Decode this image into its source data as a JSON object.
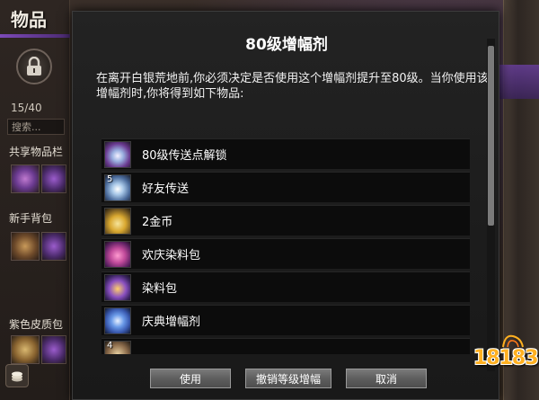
{
  "inventory": {
    "title": "物品",
    "count": "15/40",
    "search_placeholder": "搜索...",
    "categories": [
      "共享物品栏",
      "新手背包",
      "紫色皮质包"
    ]
  },
  "dialog": {
    "title": "80级增幅剂",
    "description": "在离开白银荒地前,你必须决定是否使用这个增幅剂提升至80级。当你使用该增幅剂时,你将得到如下物品:",
    "items": [
      {
        "label": "80级传送点解锁",
        "icon": "waypoint-crystal-icon",
        "badge": ""
      },
      {
        "label": "好友传送",
        "icon": "friend-teleport-icon",
        "badge": "5"
      },
      {
        "label": "2金币",
        "icon": "gold-coins-icon",
        "badge": ""
      },
      {
        "label": "欢庆染料包",
        "icon": "celebration-dye-pack-icon",
        "badge": ""
      },
      {
        "label": "染料包",
        "icon": "dye-pack-icon",
        "badge": ""
      },
      {
        "label": "庆典增幅剂",
        "icon": "celebration-booster-icon",
        "badge": ""
      },
      {
        "label": "",
        "icon": "next-item-icon",
        "badge": "4"
      }
    ],
    "buttons": {
      "use": "使用",
      "cancel_upgrade": "撤销等级增幅",
      "cancel": "取消"
    }
  },
  "watermark": "18183",
  "colors": {
    "accent_purple": "#7c4ab8",
    "dialog_bg": "#1c1c1c",
    "row_bg": "#0c0c0c",
    "button_gray": "#5e5e5e",
    "watermark_orange": "#ffb020"
  }
}
